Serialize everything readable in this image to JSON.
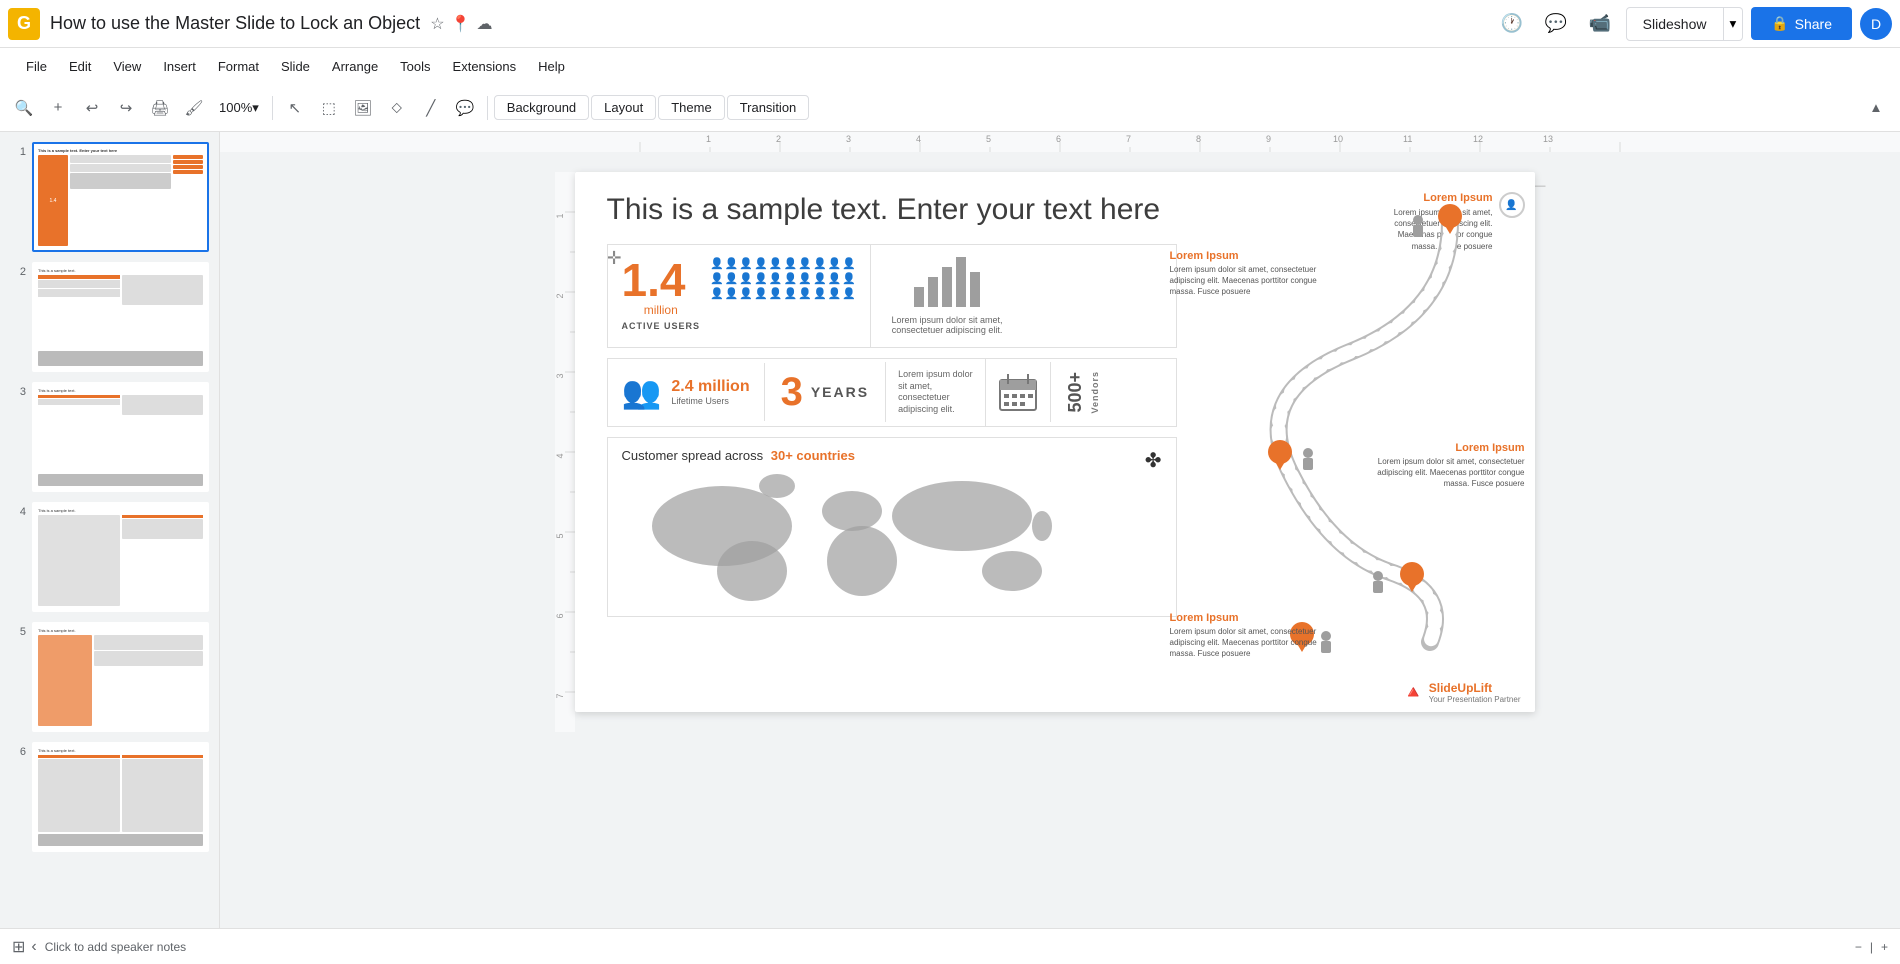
{
  "app": {
    "icon": "G",
    "title": "How to use the Master Slide to Lock an Object",
    "favicon_color": "#f4b400"
  },
  "topbar": {
    "history_icon": "🕐",
    "chat_icon": "💬",
    "video_icon": "📹",
    "slideshow_label": "Slideshow",
    "share_label": "Share",
    "avatar_initial": "D"
  },
  "menu": {
    "items": [
      "File",
      "Edit",
      "View",
      "Insert",
      "Format",
      "Slide",
      "Arrange",
      "Tools",
      "Extensions",
      "Help"
    ]
  },
  "toolbar": {
    "zoom_label": "100%",
    "background_label": "Background",
    "layout_label": "Layout",
    "theme_label": "Theme",
    "transition_label": "Transition"
  },
  "slides": [
    {
      "num": "1",
      "active": true
    },
    {
      "num": "2",
      "active": false
    },
    {
      "num": "3",
      "active": false
    },
    {
      "num": "4",
      "active": false
    },
    {
      "num": "5",
      "active": false
    },
    {
      "num": "6",
      "active": false
    }
  ],
  "slide": {
    "title": "This is a sample text. Enter your text here",
    "active_users": {
      "number": "1.4",
      "unit": "million",
      "label": "ACTIVE USERS",
      "people_rows": 3
    },
    "bar_chart": {
      "description": "Lorem ipsum dolor sit amet, consectetuer adipiscing elit."
    },
    "lifetime": {
      "number": "2.4 million",
      "label": "Lifetime Users"
    },
    "years": {
      "number": "3",
      "label": "YEARS",
      "description": "Lorem ipsum dolor sit amet, consectetuer adipiscing elit."
    },
    "vendors": {
      "number": "500+",
      "label": "Vendors"
    },
    "countries": {
      "prefix": "Customer spread across",
      "highlight": "30+ countries"
    },
    "roadmap": [
      {
        "title": "Lorem Ipsum",
        "text": "Lorem ipsum dolor sit amet, consectetuer adipiscing elit. Maecenas porttitor congue massa. Fusce posuere"
      },
      {
        "title": "Lorem Ipsum",
        "text": "Lorem ipsum dolor sit amet, consectetuer adipiscing elit. Maecenas porttitor congue massa. Fusce posuere"
      },
      {
        "title": "Lorem Ipsum",
        "text": "Lorem ipsum dolor sit amet, consectetuer adipiscing elit. Maecenas porttitor congue massa. Fusce posuere"
      },
      {
        "title": "Lorem Ipsum",
        "text": "Lorem ipsum dolor sit amet, consectetuer adipiscing elit. Maecenas porttitor congue massa. Fusce posuere"
      }
    ]
  },
  "bottom": {
    "notes_text": "Click to add speaker notes",
    "slideuplift_text": "SlideUpLift",
    "slideuplift_sub": "Your Presentation Partner"
  }
}
